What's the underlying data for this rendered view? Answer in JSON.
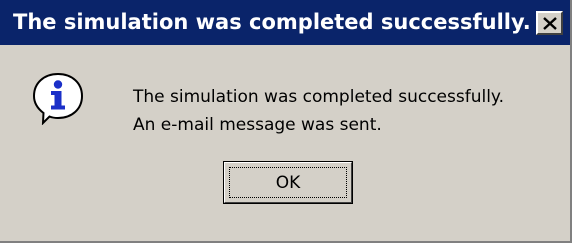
{
  "window": {
    "title": "The simulation was completed successfully.",
    "close_icon": "close-icon",
    "titlebar_color": "#0a246a",
    "title_text_color": "#ffffff",
    "background_color": "#d4d0c8"
  },
  "content": {
    "icon": "info-icon",
    "message_line1": "The simulation was completed successfully.",
    "message_line2": "An e-mail message was sent."
  },
  "buttons": {
    "ok_label": "OK"
  }
}
